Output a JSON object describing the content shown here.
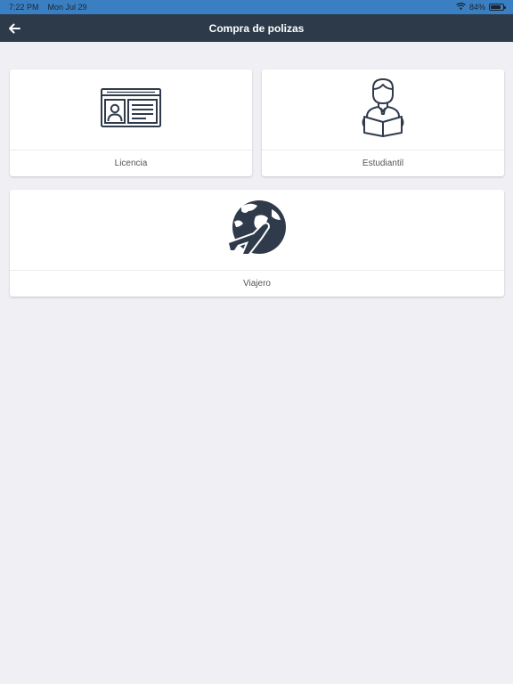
{
  "status_bar": {
    "time": "7:22 PM",
    "date": "Mon Jul 29",
    "battery_percent": "84%",
    "battery_level": 0.84,
    "wifi_icon": "wifi-icon",
    "color": "#3a7fc1"
  },
  "navbar": {
    "title": "Compra de polizas",
    "back_icon": "back-arrow-icon",
    "color": "#2c3a4a"
  },
  "cards": [
    {
      "label": "Licencia",
      "icon": "id-card-icon"
    },
    {
      "label": "Estudiantil",
      "icon": "student-reading-icon"
    },
    {
      "label": "Viajero",
      "icon": "globe-airplane-icon"
    }
  ],
  "colors": {
    "background": "#efeff4",
    "icon": "#2f3b4b"
  }
}
